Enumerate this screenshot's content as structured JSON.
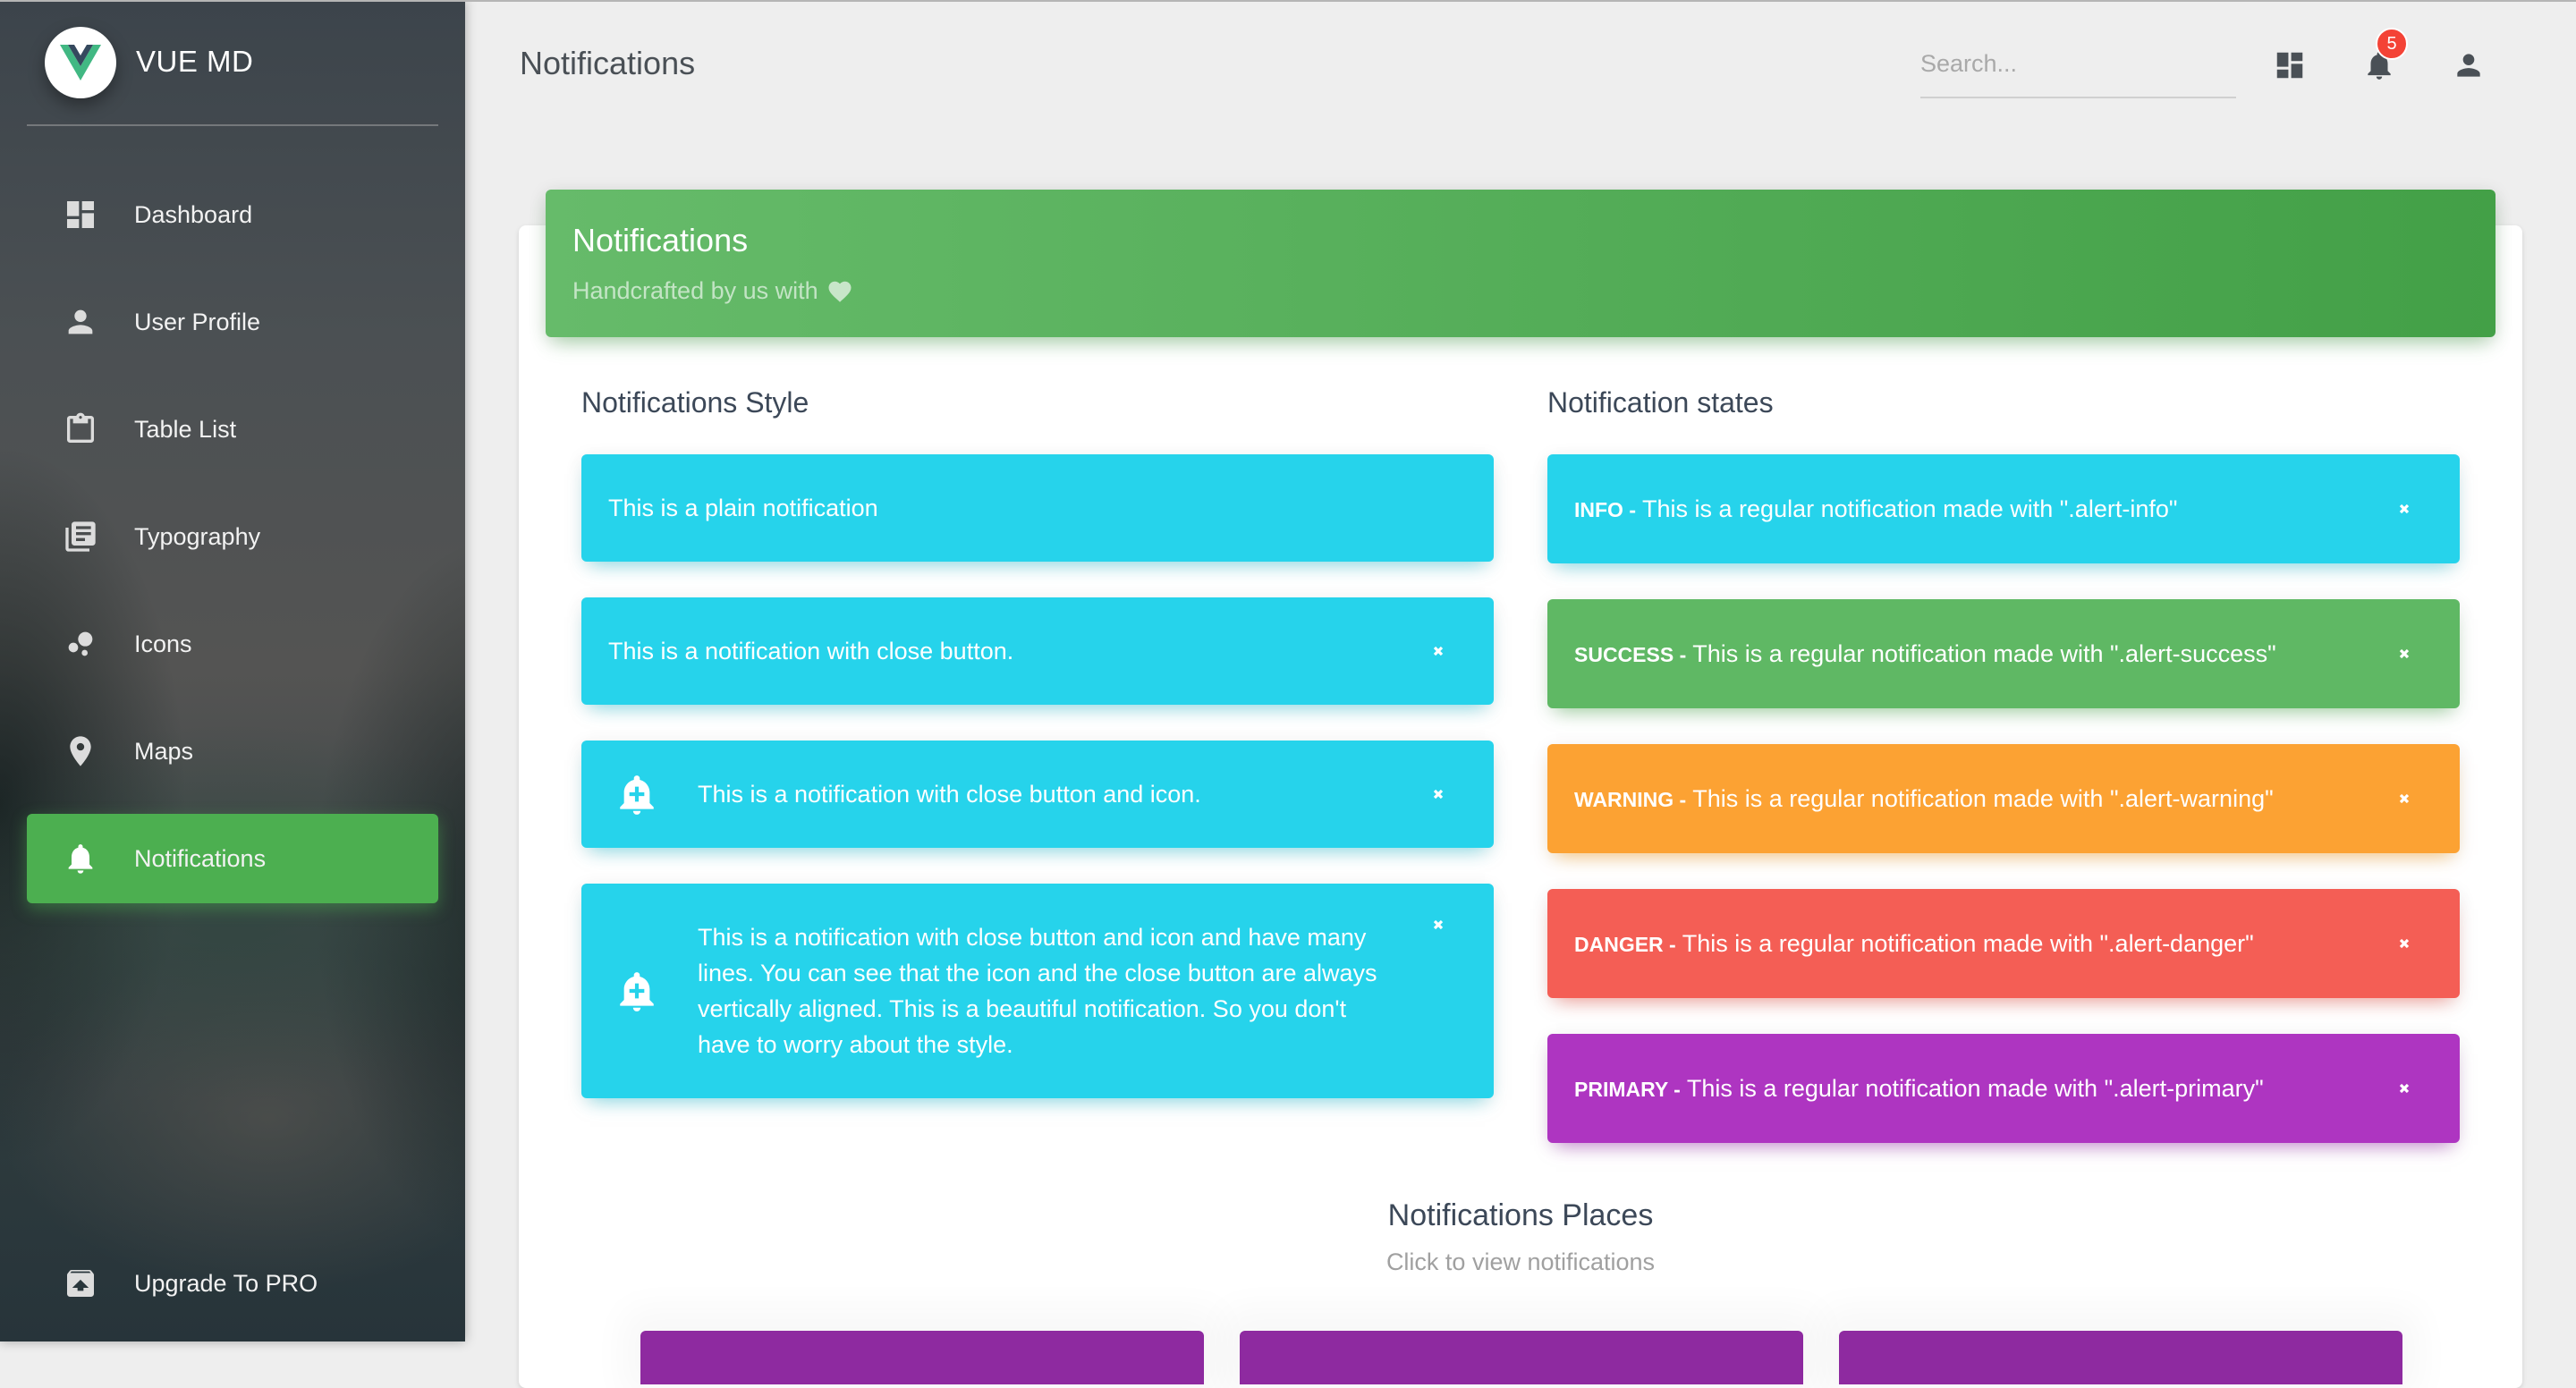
{
  "sidebar": {
    "brand": "VUE MD",
    "items": [
      {
        "label": "Dashboard",
        "icon": "dashboard-icon"
      },
      {
        "label": "User Profile",
        "icon": "person-icon"
      },
      {
        "label": "Table List",
        "icon": "clipboard-icon"
      },
      {
        "label": "Typography",
        "icon": "library-books-icon"
      },
      {
        "label": "Icons",
        "icon": "bubble-chart-icon"
      },
      {
        "label": "Maps",
        "icon": "location-pin-icon"
      },
      {
        "label": "Notifications",
        "icon": "bell-icon",
        "active": true
      }
    ],
    "upgrade": {
      "label": "Upgrade To PRO",
      "icon": "unarchive-icon"
    }
  },
  "header": {
    "title": "Notifications",
    "search_placeholder": "Search...",
    "notification_count": "5",
    "icons": [
      "dashboard-icon",
      "bell-icon",
      "person-icon"
    ]
  },
  "card": {
    "title": "Notifications",
    "subtitle": "Handcrafted by us with",
    "subtitle_icon": "heart-icon"
  },
  "styles_section": {
    "title": "Notifications Style",
    "alerts": [
      {
        "text": "This is a plain notification",
        "close": false,
        "icon": false
      },
      {
        "text": "This is a notification with close button.",
        "close": true,
        "icon": false
      },
      {
        "text": "This is a notification with close button and icon.",
        "close": true,
        "icon": true
      },
      {
        "text": "This is a notification with close button and icon and have many lines. You can see that the icon and the close button are always vertically aligned. This is a beautiful notification. So you don't have to worry about the style.",
        "close": true,
        "icon": true
      }
    ]
  },
  "states_section": {
    "title": "Notification states",
    "alerts": [
      {
        "label": "INFO -",
        "text": " This is a regular notification made with \".alert-info\"",
        "color": "#26d3eb"
      },
      {
        "label": "SUCCESS -",
        "text": " This is a regular notification made with \".alert-success\"",
        "color": "#5fb864"
      },
      {
        "label": "WARNING -",
        "text": " This is a regular notification made with \".alert-warning\"",
        "color": "#fca233"
      },
      {
        "label": "DANGER -",
        "text": " This is a regular notification made with \".alert-danger\"",
        "color": "#f45e55"
      },
      {
        "label": "PRIMARY -",
        "text": " This is a regular notification made with \".alert-primary\"",
        "color": "#ae35c1"
      }
    ]
  },
  "places_section": {
    "title": "Notifications Places",
    "subtitle": "Click to view notifications",
    "button_color": "#8e2aa0"
  },
  "colors": {
    "accent": "#4caf50",
    "badge": "#f44336"
  }
}
